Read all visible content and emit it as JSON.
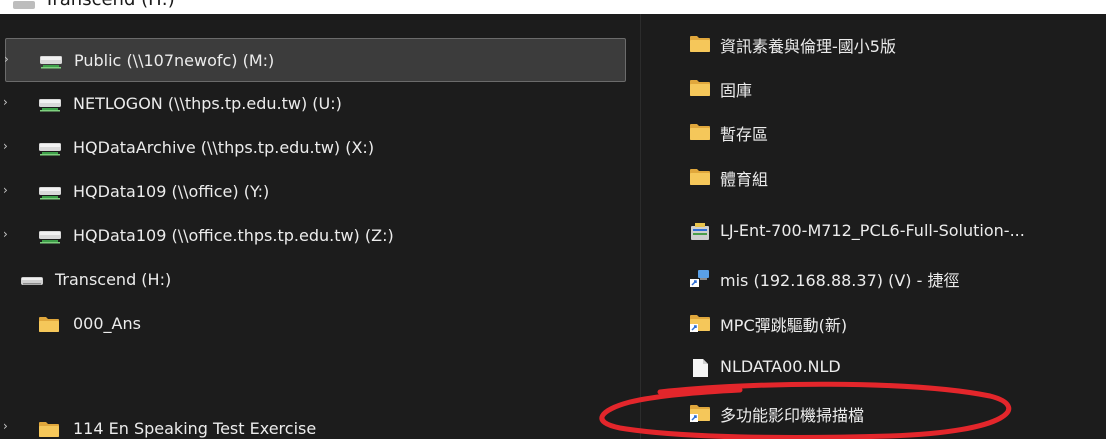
{
  "top": {
    "partial_title": "Transcend (H:)"
  },
  "nav": {
    "items": [
      {
        "label": "Public (\\\\107newofc) (M:)",
        "kind": "network-drive",
        "selected": true
      },
      {
        "label": "NETLOGON (\\\\thps.tp.edu.tw) (U:)",
        "kind": "network-drive"
      },
      {
        "label": "HQDataArchive (\\\\thps.tp.edu.tw) (X:)",
        "kind": "network-drive"
      },
      {
        "label": "HQData109 (\\\\office) (Y:)",
        "kind": "network-drive"
      },
      {
        "label": "HQData109 (\\\\office.thps.tp.edu.tw) (Z:)",
        "kind": "network-drive"
      },
      {
        "label": "Transcend (H:)",
        "kind": "drive"
      },
      {
        "label": "000_Ans",
        "kind": "folder"
      },
      {
        "label": "114 En Speaking Test Exercise",
        "kind": "folder"
      }
    ]
  },
  "content": {
    "items": [
      {
        "label": "資訊素養與倫理-國小5版",
        "kind": "folder"
      },
      {
        "label": "固庫",
        "kind": "folder"
      },
      {
        "label": "暫存區",
        "kind": "folder"
      },
      {
        "label": "體育組",
        "kind": "folder"
      },
      {
        "label": "LJ-Ent-700-M712_PCL6-Full-Solution-...",
        "kind": "installer"
      },
      {
        "label": "mis (192.168.88.37) (V) - 捷徑",
        "kind": "shortcut"
      },
      {
        "label": "MPC彈跳驅動(新)",
        "kind": "folder-shortcut"
      },
      {
        "label": "NLDATA00.NLD",
        "kind": "file"
      },
      {
        "label": "多功能影印機掃描檔",
        "kind": "folder-shortcut"
      }
    ]
  },
  "colors": {
    "background": "#1c1c1c",
    "selection": "#3c3c3c",
    "folder": "#f2c45a",
    "annotation": "#e3262b"
  }
}
